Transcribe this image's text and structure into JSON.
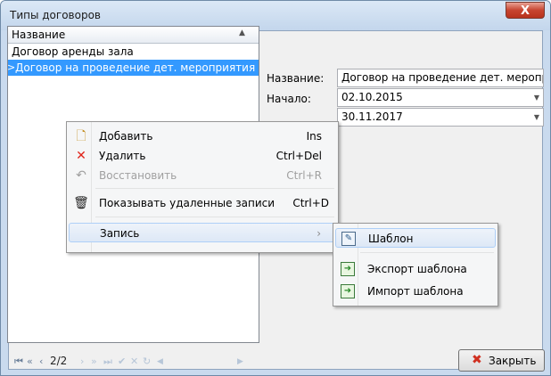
{
  "window": {
    "title": "Типы договоров",
    "close_glyph": "X"
  },
  "toolbar": [
    {
      "name": "new-document-icon",
      "glyph": "🗋",
      "color": "#c08a1a"
    },
    {
      "name": "delete-x-icon",
      "glyph": "✕",
      "color": "#e0241a"
    },
    {
      "name": "trash-icon",
      "glyph": "🗑",
      "color": "#222222"
    }
  ],
  "grid": {
    "header": "Название",
    "sort_glyph": "▲",
    "rows": [
      {
        "text": "Договор аренды зала",
        "selected": false
      },
      {
        "text": "Договор на проведение дет. мероприятия",
        "selected": true
      }
    ],
    "row_indicator": ">"
  },
  "navigator": {
    "first": "⏮",
    "prev_page": "«",
    "prev": "‹",
    "page": "2/2",
    "next": "›",
    "next_page": "»",
    "last": "⏭",
    "post": "✔",
    "cancel": "✕",
    "refresh": "↻",
    "scroll_left": "◀",
    "scroll_right": "▶"
  },
  "form": {
    "name_label": "Название:",
    "name_value": "Договор на проведение дет. мероприя",
    "start_label": "Начало:",
    "start_value": "02.10.2015",
    "end_value": "30.11.2017",
    "dropdown_glyph": "▼"
  },
  "close_button": {
    "label": "Закрыть",
    "glyph": "✖"
  },
  "context_menu": {
    "items": [
      {
        "label": "Добавить",
        "shortcut": "Ins",
        "icon": "🗋",
        "icon_name": "add-icon",
        "disabled": false
      },
      {
        "label": "Удалить",
        "shortcut": "Ctrl+Del",
        "icon": "✕",
        "icon_name": "delete-icon",
        "disabled": false
      },
      {
        "label": "Восстановить",
        "shortcut": "Ctrl+R",
        "icon": "↶",
        "icon_name": "restore-icon",
        "disabled": true
      },
      {
        "label": "Показывать удаленные записи",
        "shortcut": "Ctrl+D",
        "icon": "🗑",
        "icon_name": "trash-icon",
        "disabled": false
      },
      {
        "label": "Запись",
        "shortcut": "",
        "icon": "",
        "icon_name": "",
        "disabled": false,
        "submenu_glyph": "›"
      }
    ]
  },
  "submenu": {
    "items": [
      {
        "label": "Шаблон",
        "icon": "✎",
        "icon_name": "template-edit-icon"
      },
      {
        "label": "Экспорт шаблона",
        "icon": "➜",
        "icon_name": "export-template-icon"
      },
      {
        "label": "Импорт шаблона",
        "icon": "➜",
        "icon_name": "import-template-icon"
      }
    ]
  }
}
